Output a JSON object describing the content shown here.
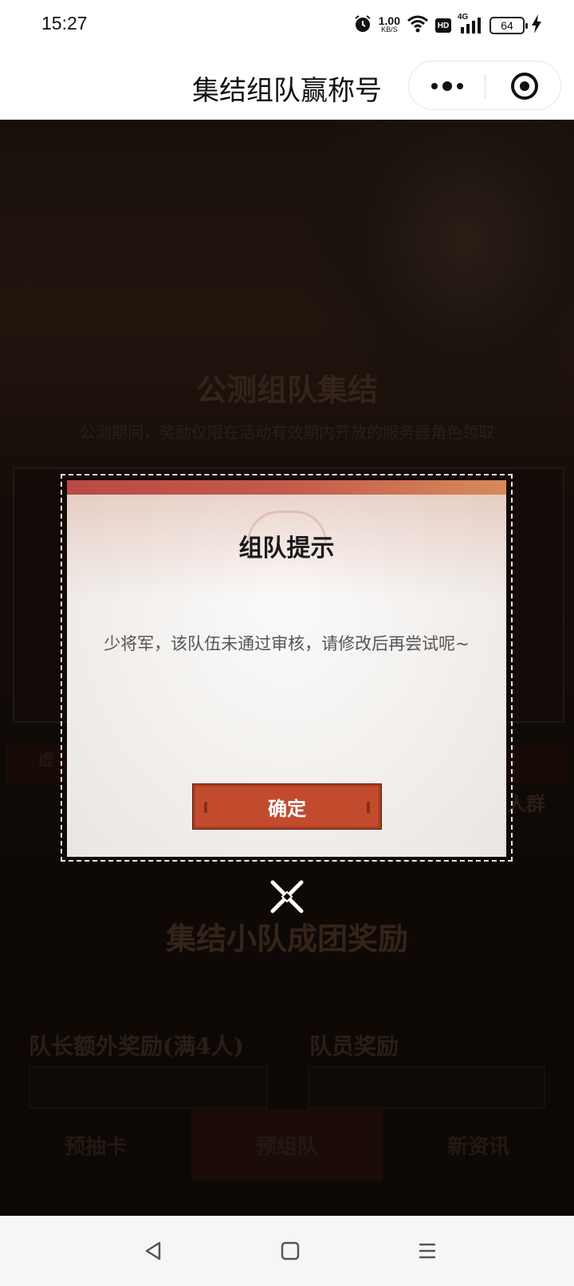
{
  "status_bar": {
    "time": "15:27",
    "net_speed": "1.00",
    "net_unit": "KB/S",
    "hd_label": "HD",
    "signal_label": "4G",
    "battery": "64",
    "icons": [
      "alarm-icon",
      "wifi-icon",
      "hd-icon",
      "signal-icon",
      "battery-icon",
      "charging-icon"
    ]
  },
  "header": {
    "title": "集结组队赢称号",
    "capsule_icons": [
      "more-icon",
      "close-miniprogram-icon"
    ]
  },
  "background": {
    "heading_1": "公测组队集结",
    "subtitle": "公测期间，奖励仅限在活动有效期内开放的服务器角色领取",
    "strip_left": "虚",
    "strip_right": "人群",
    "heading_2": "集结小队成团奖励",
    "leader_reward": "队长额外奖励(满4人)",
    "member_reward": "队员奖励",
    "tabs": [
      "预抽卡",
      "预组队",
      "新资讯"
    ]
  },
  "modal": {
    "title": "组队提示",
    "message": "少将军，该队伍未通过审核，请修改后再尝试呢~",
    "confirm_label": "确定",
    "close_icon": "close-x-icon"
  },
  "nav": {
    "icons": [
      "back-icon",
      "home-icon",
      "menu-icon"
    ]
  }
}
